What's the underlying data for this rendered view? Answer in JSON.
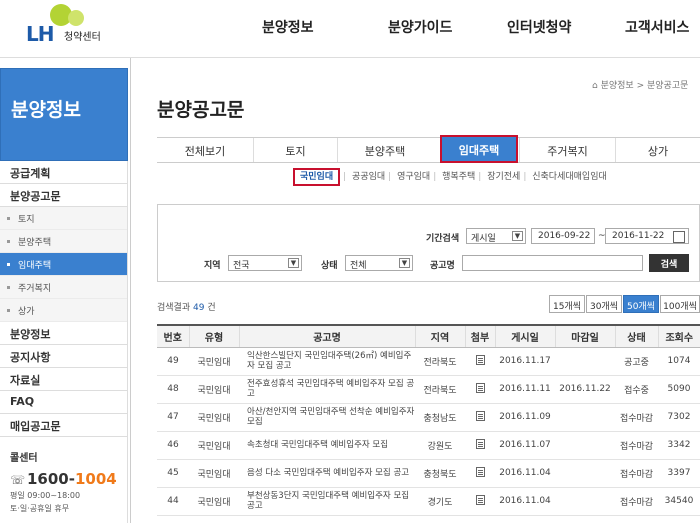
{
  "header": {
    "logo_mark": "LH",
    "logo_sub": "청약센터",
    "nav": [
      "분양정보",
      "분양가이드",
      "인터넷청약",
      "고객서비스"
    ]
  },
  "sidebar": {
    "title": "분양정보",
    "menu": [
      {
        "label": "공급계획"
      },
      {
        "label": "분양공고문"
      }
    ],
    "submenu": [
      {
        "label": "토지",
        "active": false
      },
      {
        "label": "분양주택",
        "active": false
      },
      {
        "label": "임대주택",
        "active": true
      },
      {
        "label": "주거복지",
        "active": false
      },
      {
        "label": "상가",
        "active": false
      }
    ],
    "menu2": [
      {
        "label": "분양정보"
      },
      {
        "label": "공지사항"
      },
      {
        "label": "자료실"
      },
      {
        "label": "FAQ"
      },
      {
        "label": "매입공고문"
      }
    ],
    "callcenter": {
      "title": "콜센터",
      "phone_a": "1600-",
      "phone_b": "1004",
      "hours": "평일 09:00~18:00",
      "hours2": "토·일·공휴일 휴무"
    }
  },
  "main": {
    "breadcrumb": "분양정보 > 분양공고문",
    "title": "분양공고문",
    "tabs": [
      "전체보기",
      "토지",
      "분양주택",
      "임대주택",
      "주거복지",
      "상가"
    ],
    "active_tab": "임대주택",
    "subtabs": [
      "국민임대",
      "공공임대",
      "영구임대",
      "행복주택",
      "장기전세",
      "신축다세대매입임대"
    ],
    "active_subtab": "국민임대",
    "search": {
      "period_label": "기간검색",
      "period_type": "게시일",
      "date_from": "2016-09-22",
      "date_sep": "~",
      "date_to": "2016-11-22",
      "region_label": "지역",
      "region_value": "전국",
      "status_label": "상태",
      "status_value": "전체",
      "name_label": "공고명",
      "name_value": "",
      "button": "검색"
    },
    "result": {
      "prefix": "검색결과",
      "count": "49",
      "suffix": "건"
    },
    "page_sizes": [
      "15개씩",
      "30개씩",
      "50개씩",
      "100개씩"
    ],
    "active_page_size": "50개씩",
    "table": {
      "headers": [
        "번호",
        "유형",
        "공고명",
        "지역",
        "첨부",
        "게시일",
        "마감일",
        "상태",
        "조회수"
      ],
      "rows": [
        {
          "no": "49",
          "type": "국민임대",
          "title": "익산한스빌단지 국민임대주택(26㎡) 예비입주자 모집 공고",
          "region": "전라북도",
          "posted": "2016.11.17",
          "deadline": "",
          "status": "공고중",
          "views": "1074"
        },
        {
          "no": "48",
          "type": "국민임대",
          "title": "전주효성휴석 국민임대주택 예비입주자 모집 공고",
          "region": "전라북도",
          "posted": "2016.11.11",
          "deadline": "2016.11.22",
          "status": "접수중",
          "views": "5090"
        },
        {
          "no": "47",
          "type": "국민임대",
          "title": "아산/천안지역 국민임대주택 선착순 예비입주자 모집",
          "region": "충청남도",
          "posted": "2016.11.09",
          "deadline": "",
          "status": "접수마감",
          "views": "7302"
        },
        {
          "no": "46",
          "type": "국민임대",
          "title": "속초청대 국민임대주택 예비입주자 모집",
          "region": "강원도",
          "posted": "2016.11.07",
          "deadline": "",
          "status": "접수마감",
          "views": "3342"
        },
        {
          "no": "45",
          "type": "국민임대",
          "title": "음성 다소 국민임대주택 예비입주자 모집 공고",
          "region": "충청북도",
          "posted": "2016.11.04",
          "deadline": "",
          "status": "접수마감",
          "views": "3397"
        },
        {
          "no": "44",
          "type": "국민임대",
          "title": "부천상동3단지 국민임대주택 예비입주자 모집 공고",
          "region": "경기도",
          "posted": "2016.11.04",
          "deadline": "",
          "status": "접수마감",
          "views": "34540"
        }
      ]
    }
  }
}
